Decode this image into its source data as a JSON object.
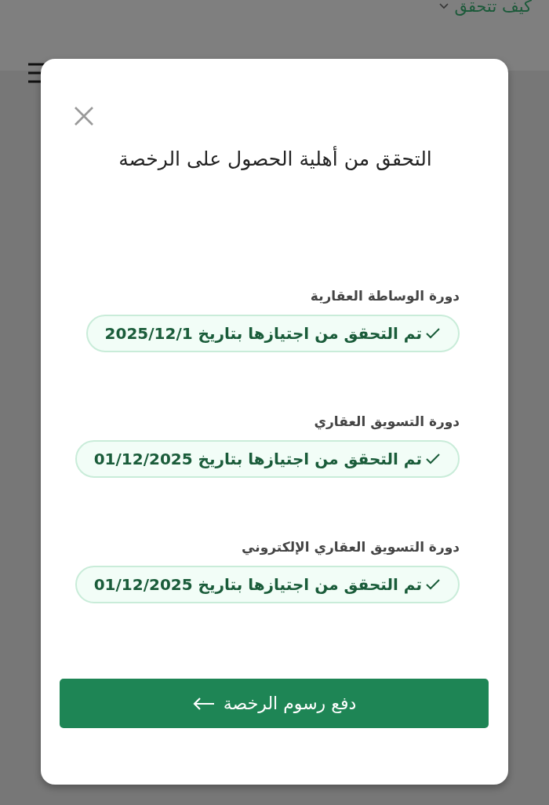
{
  "header": {
    "link": "كيف تتحقق"
  },
  "dialog": {
    "title": "التحقق من أهلية الحصول على الرخصة",
    "courses": [
      {
        "label": "دورة الوساطة العقارية",
        "status": "تم التحقق من اجتيازها بتاريخ 2025/12/1",
        "verified": true
      },
      {
        "label": "دورة التسويق العقاري",
        "status": "تم التحقق من اجتيازها بتاريخ 01/12/2025",
        "verified": true
      },
      {
        "label": "دورة التسويق العقاري الإلكتروني",
        "status": "تم التحقق من اجتيازها بتاريخ 01/12/2025",
        "verified": true
      }
    ],
    "button": "دفع رسوم الرخصة"
  }
}
